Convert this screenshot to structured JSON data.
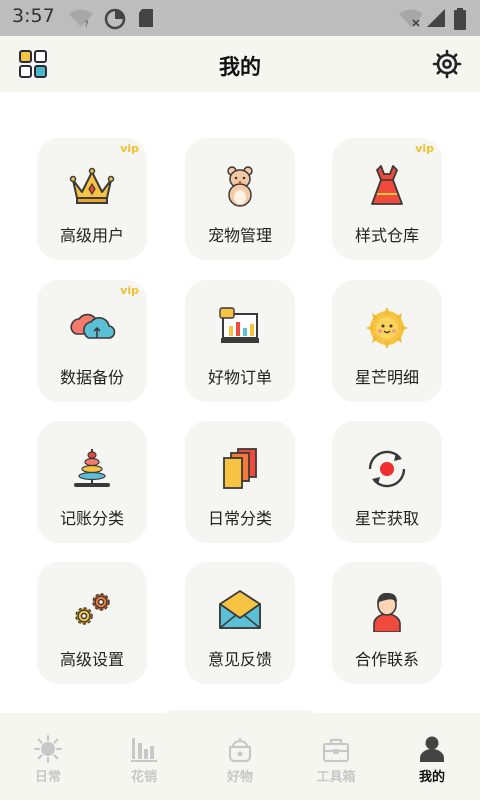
{
  "status_bar": {
    "time": "3:57"
  },
  "header": {
    "title": "我的",
    "left_icon": "grid-apps-icon",
    "right_icon": "gear-icon"
  },
  "grid": [
    {
      "label": "高级用户",
      "icon": "crown-icon",
      "vip": "vip"
    },
    {
      "label": "宠物管理",
      "icon": "hamster-icon",
      "vip": ""
    },
    {
      "label": "样式仓库",
      "icon": "dress-icon",
      "vip": "vip"
    },
    {
      "label": "数据备份",
      "icon": "cloud-sync-icon",
      "vip": "vip"
    },
    {
      "label": "好物订单",
      "icon": "order-board-icon",
      "vip": ""
    },
    {
      "label": "星芒明细",
      "icon": "sun-icon",
      "vip": ""
    },
    {
      "label": "记账分类",
      "icon": "stacking-rings-icon",
      "vip": ""
    },
    {
      "label": "日常分类",
      "icon": "cards-icon",
      "vip": ""
    },
    {
      "label": "星芒获取",
      "icon": "record-refresh-icon",
      "vip": ""
    },
    {
      "label": "高级设置",
      "icon": "gears-icon",
      "vip": ""
    },
    {
      "label": "意见反馈",
      "icon": "mail-icon",
      "vip": ""
    },
    {
      "label": "合作联系",
      "icon": "person-icon",
      "vip": ""
    }
  ],
  "bottom_nav": [
    {
      "label": "日常",
      "icon": "sun-outline-icon",
      "active": false
    },
    {
      "label": "花销",
      "icon": "bar-chart-icon",
      "active": false
    },
    {
      "label": "好物",
      "icon": "pot-icon",
      "active": false
    },
    {
      "label": "工具箱",
      "icon": "toolbox-icon",
      "active": false
    },
    {
      "label": "我的",
      "icon": "user-icon",
      "active": true
    }
  ],
  "colors": {
    "vip": "#f0c130",
    "card_bg": "#f5f5f1",
    "nav_inactive": "#c8c8c8",
    "nav_active": "#111111"
  }
}
